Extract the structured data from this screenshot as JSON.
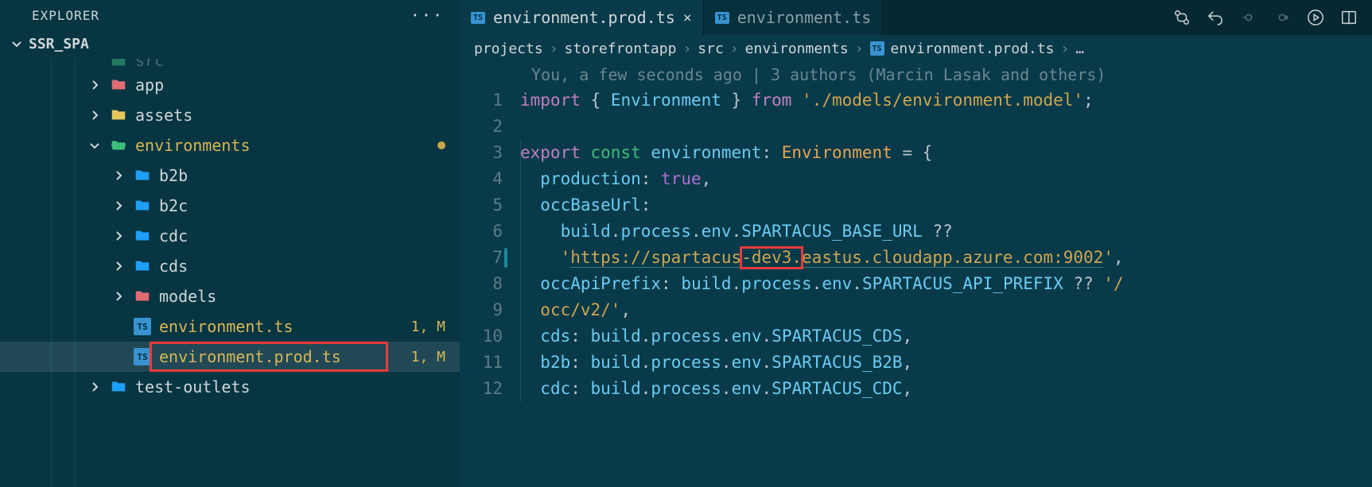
{
  "explorer": {
    "title": "EXPLORER",
    "root": "SSR_SPA",
    "tree": [
      {
        "depth": 2,
        "icon": "folder-green",
        "chev": "none",
        "label": "src",
        "class": "dim-text",
        "cutoff": true
      },
      {
        "depth": 2,
        "icon": "folder-red",
        "chev": "right",
        "label": "app"
      },
      {
        "depth": 2,
        "icon": "folder-yellow",
        "chev": "right",
        "label": "assets"
      },
      {
        "depth": 2,
        "icon": "folder-green-open",
        "chev": "down",
        "label": "environments",
        "class": "accent-text",
        "dot": true
      },
      {
        "depth": 3,
        "icon": "folder-blue",
        "chev": "right",
        "label": "b2b"
      },
      {
        "depth": 3,
        "icon": "folder-blue",
        "chev": "right",
        "label": "b2c"
      },
      {
        "depth": 3,
        "icon": "folder-blue",
        "chev": "right",
        "label": "cdc"
      },
      {
        "depth": 3,
        "icon": "folder-blue",
        "chev": "right",
        "label": "cds"
      },
      {
        "depth": 3,
        "icon": "folder-red",
        "chev": "right",
        "label": "models"
      },
      {
        "depth": 3,
        "icon": "ts",
        "chev": "none",
        "label": "environment.ts",
        "class": "accent-text",
        "badge": "1, M"
      },
      {
        "depth": 3,
        "icon": "ts",
        "chev": "none",
        "label": "environment.prod.ts",
        "class": "accent-text",
        "badge": "1, M",
        "selected": true,
        "redbox": true
      },
      {
        "depth": 2,
        "icon": "folder-blue",
        "chev": "right",
        "label": "test-outlets"
      }
    ]
  },
  "tabs": {
    "items": [
      {
        "label": "environment.prod.ts",
        "active": true,
        "close": true
      },
      {
        "label": "environment.ts",
        "active": false,
        "close": false
      }
    ]
  },
  "breadcrumb": {
    "parts": [
      "projects",
      "storefrontapp",
      "src",
      "environments"
    ],
    "file": "environment.prod.ts",
    "tail": "…"
  },
  "blame": "You, a few seconds ago | 3 authors (Marcin Lasak and others)",
  "code": {
    "lines": [
      [
        {
          "t": "import ",
          "c": "tk-kw2"
        },
        {
          "t": "{ ",
          "c": "tk-punct"
        },
        {
          "t": "Environment ",
          "c": "tk-var"
        },
        {
          "t": "} ",
          "c": "tk-punct"
        },
        {
          "t": "from ",
          "c": "tk-kw2"
        },
        {
          "t": "'./models/environment.model'",
          "c": "tk-str"
        },
        {
          "t": ";",
          "c": "tk-punct"
        }
      ],
      [],
      [
        {
          "t": "export ",
          "c": "tk-kw2"
        },
        {
          "t": "const ",
          "c": "tk-kw"
        },
        {
          "t": "environment",
          "c": "tk-var"
        },
        {
          "t": ": ",
          "c": "tk-punct"
        },
        {
          "t": "Environment ",
          "c": "tk-type"
        },
        {
          "t": "= {",
          "c": "tk-punct"
        }
      ],
      [
        {
          "t": "  ",
          "c": "tk-plain"
        },
        {
          "t": "production",
          "c": "tk-var"
        },
        {
          "t": ": ",
          "c": "tk-punct"
        },
        {
          "t": "true",
          "c": "tk-bool"
        },
        {
          "t": ",",
          "c": "tk-punct"
        }
      ],
      [
        {
          "t": "  ",
          "c": "tk-plain"
        },
        {
          "t": "occBaseUrl",
          "c": "tk-var"
        },
        {
          "t": ":",
          "c": "tk-punct"
        }
      ],
      [
        {
          "t": "    ",
          "c": "tk-plain"
        },
        {
          "t": "build",
          "c": "tk-var"
        },
        {
          "t": ".",
          "c": "tk-punct"
        },
        {
          "t": "process",
          "c": "tk-var"
        },
        {
          "t": ".",
          "c": "tk-punct"
        },
        {
          "t": "env",
          "c": "tk-var"
        },
        {
          "t": ".",
          "c": "tk-punct"
        },
        {
          "t": "SPARTACUS_BASE_URL ",
          "c": "tk-var"
        },
        {
          "t": "??",
          "c": "tk-punct"
        }
      ],
      [
        {
          "t": "    ",
          "c": "tk-plain"
        },
        {
          "t": "'",
          "c": "tk-str"
        },
        {
          "t": "https://spartacus",
          "c": "tk-str underline"
        },
        {
          "t": "-dev3.",
          "c": "tk-str underline",
          "box": true
        },
        {
          "t": "eastus.cloudapp.azure.com:9002",
          "c": "tk-str underline"
        },
        {
          "t": "'",
          "c": "tk-str"
        },
        {
          "t": ",",
          "c": "tk-punct"
        }
      ],
      [
        {
          "t": "  ",
          "c": "tk-plain"
        },
        {
          "t": "occApiPrefix",
          "c": "tk-var"
        },
        {
          "t": ": ",
          "c": "tk-punct"
        },
        {
          "t": "build",
          "c": "tk-var"
        },
        {
          "t": ".",
          "c": "tk-punct"
        },
        {
          "t": "process",
          "c": "tk-var"
        },
        {
          "t": ".",
          "c": "tk-punct"
        },
        {
          "t": "env",
          "c": "tk-var"
        },
        {
          "t": ".",
          "c": "tk-punct"
        },
        {
          "t": "SPARTACUS_API_PREFIX ",
          "c": "tk-var"
        },
        {
          "t": "?? ",
          "c": "tk-punct"
        },
        {
          "t": "'/",
          "c": "tk-str"
        }
      ],
      [
        {
          "t": "  ",
          "c": "tk-plain"
        },
        {
          "t": "occ/v2/'",
          "c": "tk-str"
        },
        {
          "t": ",",
          "c": "tk-punct"
        }
      ],
      [
        {
          "t": "  ",
          "c": "tk-plain"
        },
        {
          "t": "cds",
          "c": "tk-var"
        },
        {
          "t": ": ",
          "c": "tk-punct"
        },
        {
          "t": "build",
          "c": "tk-var"
        },
        {
          "t": ".",
          "c": "tk-punct"
        },
        {
          "t": "process",
          "c": "tk-var"
        },
        {
          "t": ".",
          "c": "tk-punct"
        },
        {
          "t": "env",
          "c": "tk-var"
        },
        {
          "t": ".",
          "c": "tk-punct"
        },
        {
          "t": "SPARTACUS_CDS",
          "c": "tk-var"
        },
        {
          "t": ",",
          "c": "tk-punct"
        }
      ],
      [
        {
          "t": "  ",
          "c": "tk-plain"
        },
        {
          "t": "b2b",
          "c": "tk-var"
        },
        {
          "t": ": ",
          "c": "tk-punct"
        },
        {
          "t": "build",
          "c": "tk-var"
        },
        {
          "t": ".",
          "c": "tk-punct"
        },
        {
          "t": "process",
          "c": "tk-var"
        },
        {
          "t": ".",
          "c": "tk-punct"
        },
        {
          "t": "env",
          "c": "tk-var"
        },
        {
          "t": ".",
          "c": "tk-punct"
        },
        {
          "t": "SPARTACUS_B2B",
          "c": "tk-var"
        },
        {
          "t": ",",
          "c": "tk-punct"
        }
      ],
      [
        {
          "t": "  ",
          "c": "tk-plain"
        },
        {
          "t": "cdc",
          "c": "tk-var"
        },
        {
          "t": ": ",
          "c": "tk-punct"
        },
        {
          "t": "build",
          "c": "tk-var"
        },
        {
          "t": ".",
          "c": "tk-punct"
        },
        {
          "t": "process",
          "c": "tk-var"
        },
        {
          "t": ".",
          "c": "tk-punct"
        },
        {
          "t": "env",
          "c": "tk-var"
        },
        {
          "t": ".",
          "c": "tk-punct"
        },
        {
          "t": "SPARTACUS_CDC",
          "c": "tk-var"
        },
        {
          "t": ",",
          "c": "tk-punct"
        }
      ]
    ],
    "start": 1,
    "modbar_line": 7
  }
}
